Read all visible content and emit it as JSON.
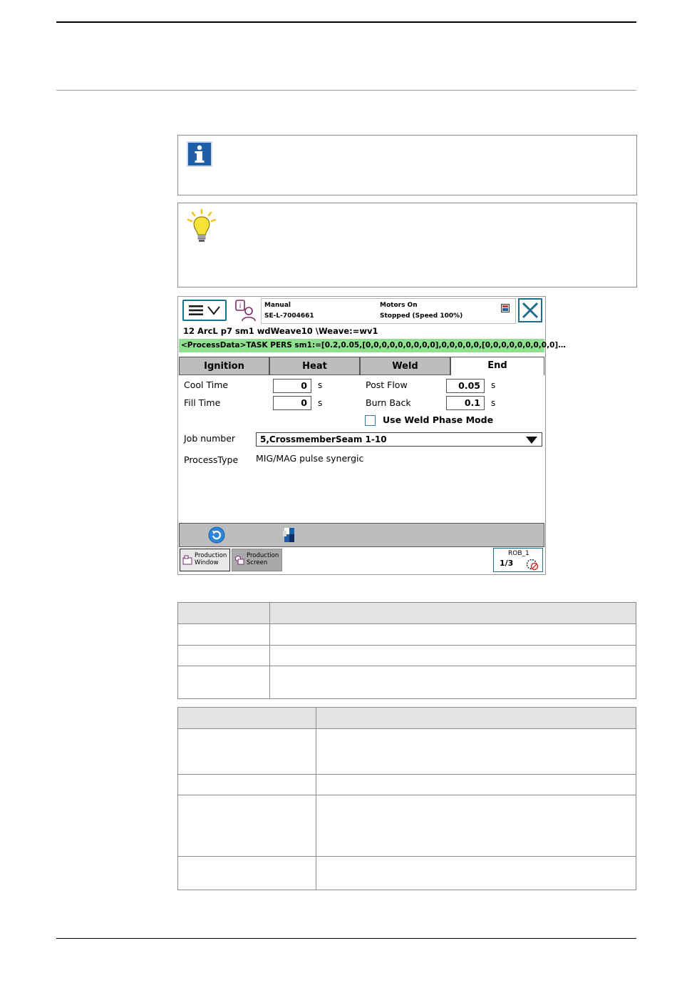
{
  "pendant": {
    "status": {
      "mode": "Manual",
      "controller": "SE-L-7004661",
      "motors": "Motors On",
      "state": "Stopped (Speed 100%)"
    },
    "routine_line": "12 ArcL p7 sm1 wdWeave10 \\Weave:=wv1",
    "process_line": "<ProcessData>TASK PERS  sm1:=[0.2,0.05,[0,0,0,0,0,0,0,0,0],0,0,0,0,0,[0,0,0,0,0,0,0,0,0]…",
    "tabs": [
      "Ignition",
      "Heat",
      "Weld",
      "End"
    ],
    "active_tab": "End",
    "fields": {
      "cool_time_label": "Cool Time",
      "cool_time_value": "0",
      "fill_time_label": "Fill Time",
      "fill_time_value": "0",
      "post_flow_label": "Post Flow",
      "post_flow_value": "0.05",
      "burn_back_label": "Burn Back",
      "burn_back_value": "0.1",
      "unit": "s",
      "weld_phase_label": "Use Weld Phase Mode",
      "weld_phase_checked": false,
      "job_number_label": "Job number",
      "job_number_value": "5,CrossmemberSeam 1-10",
      "process_type_label": "ProcessType",
      "process_type_value": "MIG/MAG pulse synergic"
    },
    "taskbar": {
      "production_window": [
        "Production",
        "Window"
      ],
      "production_screen": [
        "Production",
        "Screen"
      ],
      "robot": "ROB_1",
      "speed_fraction": "1/3"
    }
  },
  "colors": {
    "process_line_bg": "#8fe08f",
    "tab_bg": "#bdbdbd",
    "accent": "#1d6f8a",
    "info_icon": "#1f5fa8",
    "tip_bulb": "#f2d21b"
  }
}
